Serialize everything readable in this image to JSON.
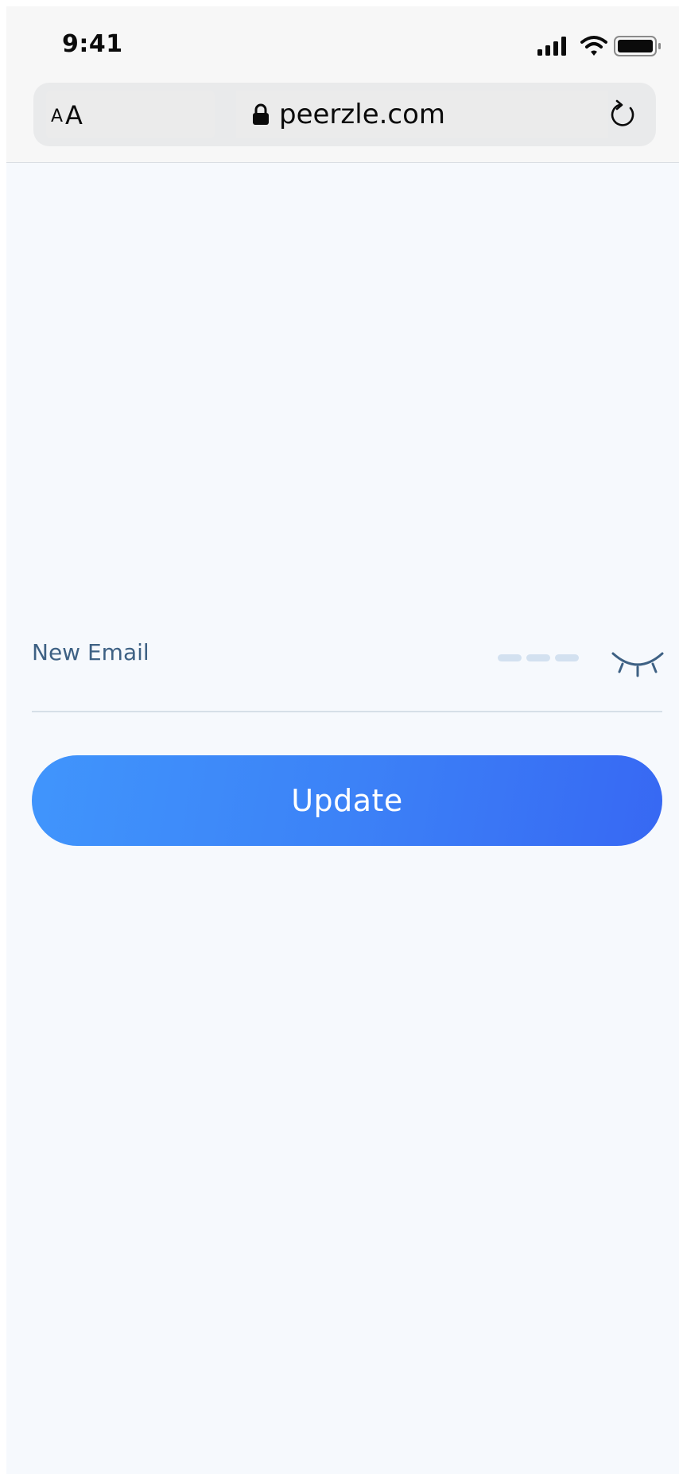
{
  "status_bar": {
    "time": "9:41",
    "icons": [
      "signal-icon",
      "wifi-icon",
      "battery-icon"
    ]
  },
  "browser": {
    "text_size_small": "A",
    "text_size_large": "A",
    "url": "peerzle.com",
    "icons": [
      "lock-icon",
      "reload-icon"
    ]
  },
  "form": {
    "email_label": "New Email",
    "email_value": "",
    "visibility_icon": "eye-closed-icon",
    "submit_label": "Update"
  },
  "colors": {
    "background": "#f6f9fd",
    "label": "#3e6184",
    "button_gradient_start": "#4095fc",
    "button_gradient_end": "#3768f3",
    "button_text": "#ffffff"
  }
}
